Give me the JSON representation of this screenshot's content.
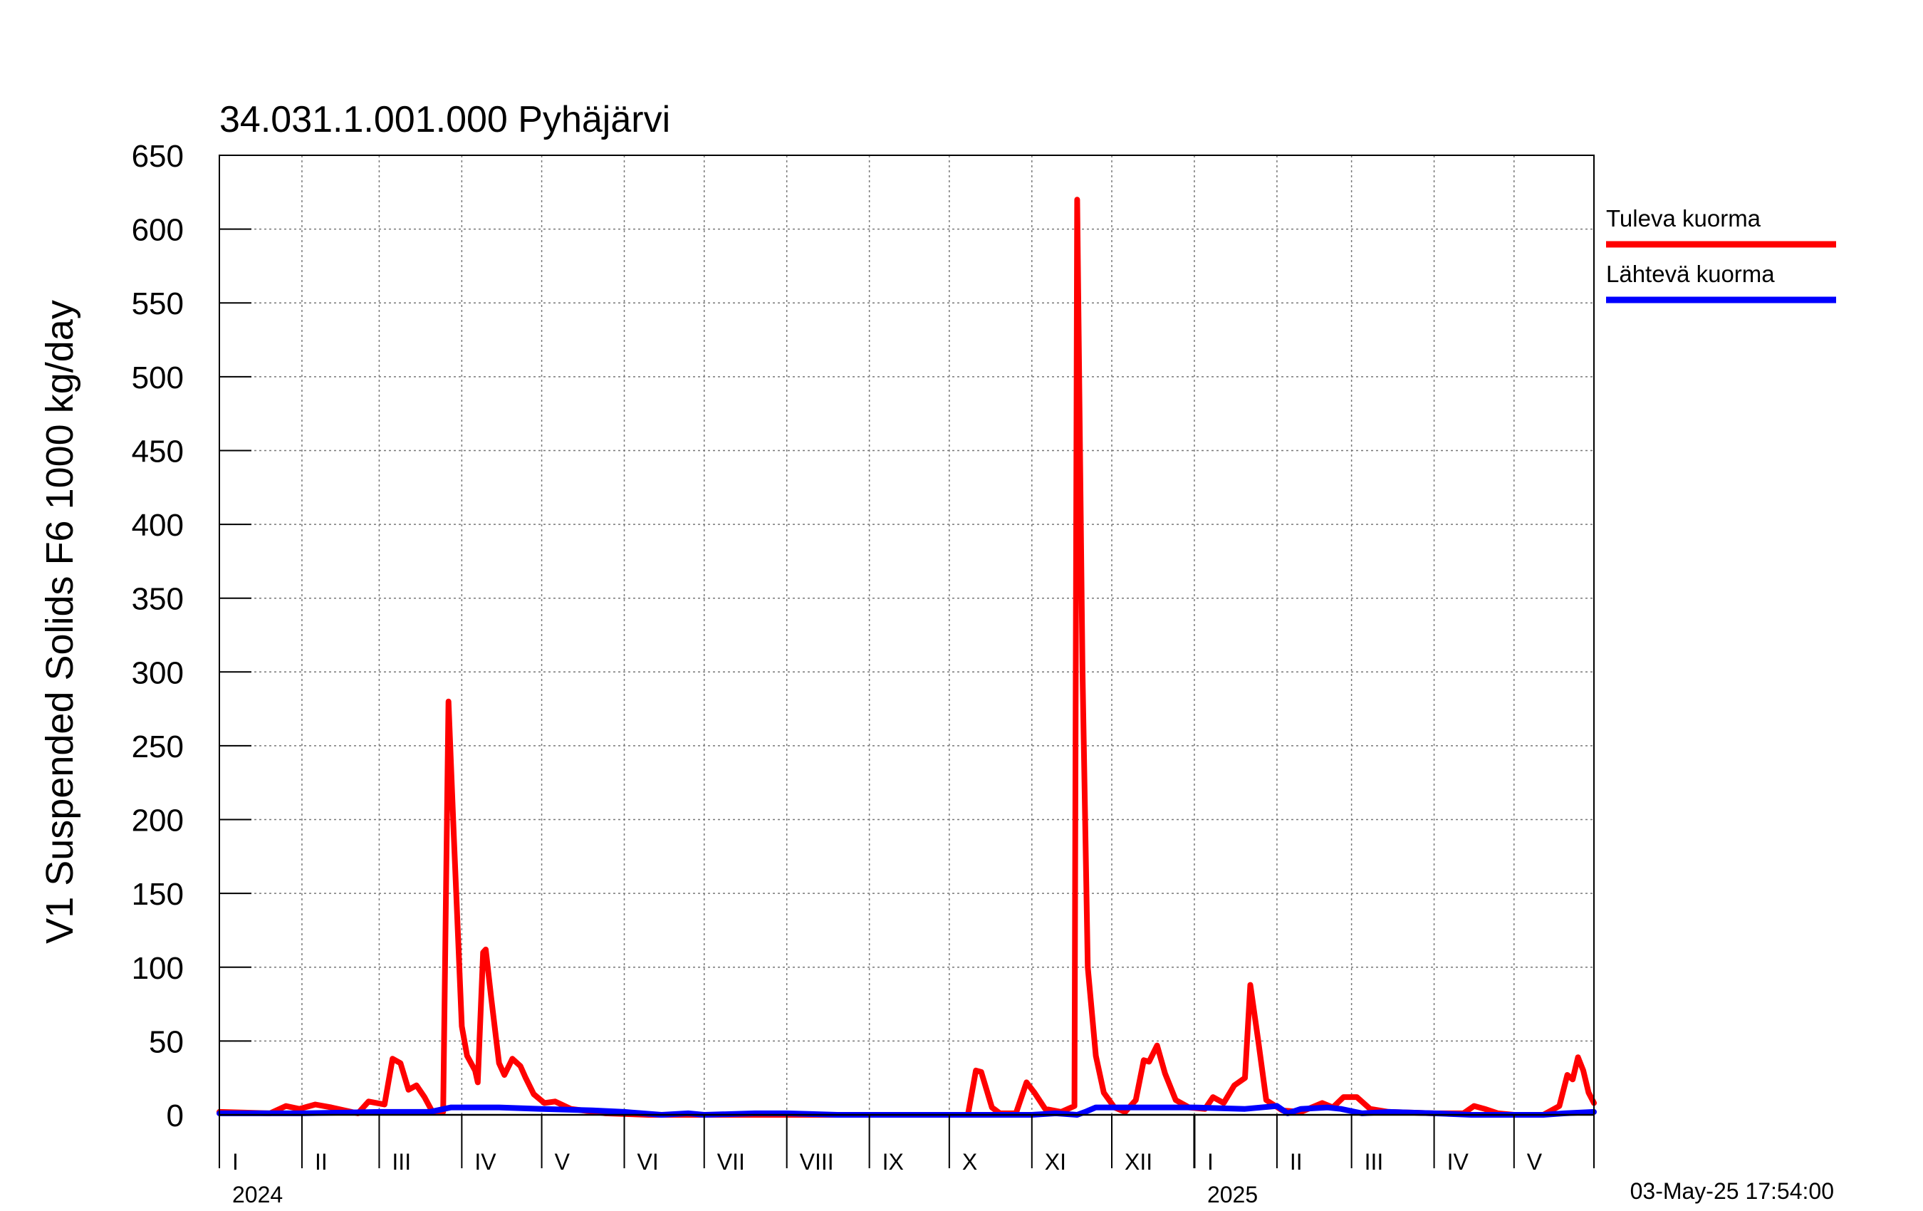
{
  "chart_data": {
    "type": "line",
    "title": "34.031.1.001.000 Pyhäjärvi",
    "ylabel": "V1 Suspended Solids F6 1000 kg/day",
    "xlabel": "",
    "ylim": [
      0,
      650
    ],
    "yticks": [
      0,
      50,
      100,
      150,
      200,
      250,
      300,
      350,
      400,
      450,
      500,
      550,
      600,
      650
    ],
    "xlim": [
      "2024-01-01",
      "2025-05-31"
    ],
    "month_labels": [
      {
        "label": "I",
        "start": "2024-01-01"
      },
      {
        "label": "II",
        "start": "2024-02-01"
      },
      {
        "label": "III",
        "start": "2024-03-01"
      },
      {
        "label": "IV",
        "start": "2024-04-01"
      },
      {
        "label": "V",
        "start": "2024-05-01"
      },
      {
        "label": "VI",
        "start": "2024-06-01"
      },
      {
        "label": "VII",
        "start": "2024-07-01"
      },
      {
        "label": "VIII",
        "start": "2024-08-01"
      },
      {
        "label": "IX",
        "start": "2024-09-01"
      },
      {
        "label": "X",
        "start": "2024-10-01"
      },
      {
        "label": "XI",
        "start": "2024-11-01"
      },
      {
        "label": "XII",
        "start": "2024-12-01"
      },
      {
        "label": "I",
        "start": "2025-01-01"
      },
      {
        "label": "II",
        "start": "2025-02-01"
      },
      {
        "label": "III",
        "start": "2025-03-01"
      },
      {
        "label": "IV",
        "start": "2025-04-01"
      },
      {
        "label": "V",
        "start": "2025-05-01"
      }
    ],
    "year_labels": [
      {
        "label": "2024",
        "at": "2024-01-01"
      },
      {
        "label": "2025",
        "at": "2025-01-01"
      }
    ],
    "grid": true,
    "legend_position": "right",
    "timestamp": "03-May-25 17:54:00",
    "series": [
      {
        "name": "Tuleva kuorma",
        "color": "#ff0000",
        "points": [
          [
            "2024-01-01",
            2
          ],
          [
            "2024-01-20",
            1
          ],
          [
            "2024-01-26",
            6
          ],
          [
            "2024-01-31",
            4
          ],
          [
            "2024-02-06",
            7
          ],
          [
            "2024-02-12",
            5
          ],
          [
            "2024-02-22",
            1
          ],
          [
            "2024-02-26",
            9
          ],
          [
            "2024-03-03",
            7
          ],
          [
            "2024-03-06",
            38
          ],
          [
            "2024-03-09",
            35
          ],
          [
            "2024-03-12",
            17
          ],
          [
            "2024-03-15",
            20
          ],
          [
            "2024-03-18",
            12
          ],
          [
            "2024-03-21",
            2
          ],
          [
            "2024-03-25",
            2
          ],
          [
            "2024-03-27",
            280
          ],
          [
            "2024-03-29",
            190
          ],
          [
            "2024-04-01",
            60
          ],
          [
            "2024-04-03",
            40
          ],
          [
            "2024-04-06",
            30
          ],
          [
            "2024-04-07",
            22
          ],
          [
            "2024-04-09",
            110
          ],
          [
            "2024-04-10",
            112
          ],
          [
            "2024-04-12",
            80
          ],
          [
            "2024-04-15",
            35
          ],
          [
            "2024-04-17",
            27
          ],
          [
            "2024-04-20",
            38
          ],
          [
            "2024-04-23",
            33
          ],
          [
            "2024-04-25",
            25
          ],
          [
            "2024-04-28",
            14
          ],
          [
            "2024-05-02",
            8
          ],
          [
            "2024-05-06",
            9
          ],
          [
            "2024-05-12",
            4
          ],
          [
            "2024-05-25",
            1
          ],
          [
            "2024-06-10",
            0
          ],
          [
            "2024-07-01",
            0
          ],
          [
            "2024-08-01",
            0
          ],
          [
            "2024-09-01",
            0
          ],
          [
            "2024-10-01",
            0
          ],
          [
            "2024-10-08",
            0
          ],
          [
            "2024-10-11",
            30
          ],
          [
            "2024-10-13",
            29
          ],
          [
            "2024-10-17",
            5
          ],
          [
            "2024-10-20",
            1
          ],
          [
            "2024-10-26",
            1
          ],
          [
            "2024-10-30",
            22
          ],
          [
            "2024-11-02",
            15
          ],
          [
            "2024-11-06",
            4
          ],
          [
            "2024-11-12",
            2
          ],
          [
            "2024-11-17",
            6
          ],
          [
            "2024-11-18",
            620
          ],
          [
            "2024-11-20",
            300
          ],
          [
            "2024-11-22",
            100
          ],
          [
            "2024-11-25",
            40
          ],
          [
            "2024-11-28",
            15
          ],
          [
            "2024-12-02",
            5
          ],
          [
            "2024-12-06",
            2
          ],
          [
            "2024-12-10",
            10
          ],
          [
            "2024-12-13",
            37
          ],
          [
            "2024-12-15",
            36
          ],
          [
            "2024-12-18",
            47
          ],
          [
            "2024-12-21",
            28
          ],
          [
            "2024-12-25",
            10
          ],
          [
            "2024-12-30",
            5
          ],
          [
            "2025-01-05",
            4
          ],
          [
            "2025-01-08",
            12
          ],
          [
            "2025-01-12",
            8
          ],
          [
            "2025-01-16",
            20
          ],
          [
            "2025-01-20",
            25
          ],
          [
            "2025-01-22",
            88
          ],
          [
            "2025-01-25",
            50
          ],
          [
            "2025-01-28",
            10
          ],
          [
            "2025-02-03",
            3
          ],
          [
            "2025-02-10",
            2
          ],
          [
            "2025-02-18",
            8
          ],
          [
            "2025-02-22",
            5
          ],
          [
            "2025-02-26",
            12
          ],
          [
            "2025-03-03",
            12
          ],
          [
            "2025-03-08",
            4
          ],
          [
            "2025-03-15",
            2
          ],
          [
            "2025-04-01",
            1
          ],
          [
            "2025-04-12",
            1
          ],
          [
            "2025-04-16",
            6
          ],
          [
            "2025-04-20",
            4
          ],
          [
            "2025-04-25",
            1
          ],
          [
            "2025-05-01",
            0
          ],
          [
            "2025-05-12",
            0
          ],
          [
            "2025-05-18",
            6
          ],
          [
            "2025-05-21",
            27
          ],
          [
            "2025-05-23",
            24
          ],
          [
            "2025-05-25",
            39
          ],
          [
            "2025-05-27",
            30
          ],
          [
            "2025-05-29",
            15
          ],
          [
            "2025-05-31",
            8
          ]
        ]
      },
      {
        "name": "Lähtevä kuorma",
        "color": "#0000ff",
        "points": [
          [
            "2024-01-01",
            1
          ],
          [
            "2024-02-01",
            1
          ],
          [
            "2024-03-01",
            2
          ],
          [
            "2024-03-20",
            2
          ],
          [
            "2024-03-28",
            5
          ],
          [
            "2024-04-15",
            5
          ],
          [
            "2024-05-01",
            4
          ],
          [
            "2024-05-20",
            3
          ],
          [
            "2024-06-01",
            2
          ],
          [
            "2024-06-15",
            0
          ],
          [
            "2024-06-25",
            1
          ],
          [
            "2024-07-01",
            0
          ],
          [
            "2024-07-20",
            1
          ],
          [
            "2024-08-01",
            1
          ],
          [
            "2024-08-20",
            0
          ],
          [
            "2024-09-01",
            0
          ],
          [
            "2024-10-01",
            0
          ],
          [
            "2024-10-20",
            0
          ],
          [
            "2024-11-01",
            0
          ],
          [
            "2024-11-10",
            1
          ],
          [
            "2024-11-18",
            0
          ],
          [
            "2024-11-21",
            2
          ],
          [
            "2024-11-25",
            5
          ],
          [
            "2024-12-01",
            5
          ],
          [
            "2024-12-15",
            5
          ],
          [
            "2025-01-01",
            5
          ],
          [
            "2025-01-20",
            4
          ],
          [
            "2025-02-01",
            6
          ],
          [
            "2025-02-05",
            1
          ],
          [
            "2025-02-10",
            4
          ],
          [
            "2025-02-20",
            5
          ],
          [
            "2025-02-25",
            4
          ],
          [
            "2025-03-05",
            1
          ],
          [
            "2025-03-15",
            2
          ],
          [
            "2025-04-01",
            1
          ],
          [
            "2025-04-15",
            0
          ],
          [
            "2025-05-01",
            0
          ],
          [
            "2025-05-12",
            0
          ],
          [
            "2025-05-20",
            1
          ],
          [
            "2025-05-31",
            2
          ]
        ]
      }
    ]
  }
}
